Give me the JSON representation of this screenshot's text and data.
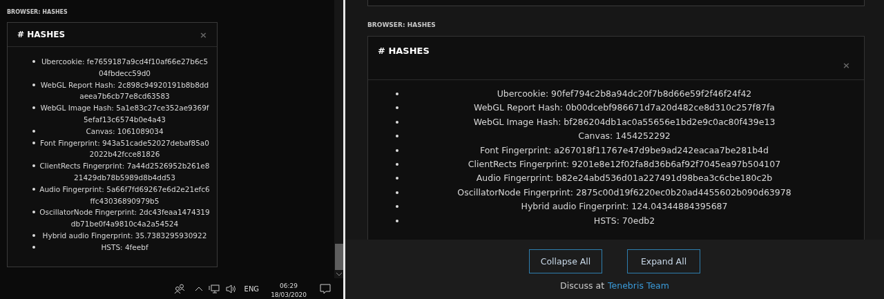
{
  "left_pane": {
    "section_label": "BROWSER: HASHES",
    "panel": {
      "icon": "#",
      "title": "HASHES",
      "close": "×",
      "items": [
        {
          "text": "Ubercookie: fe7659187a9cd4f10af66e27b6c504fbdecc59d0"
        },
        {
          "text": "WebGL Report Hash: 2c898c94920191b8b8ddaeea7b6cb77e8cd63583"
        },
        {
          "text": "WebGL Image Hash: 5a1e83c27ce352ae9369f5efaf13c6574b0e4a43"
        },
        {
          "text": "Canvas: 1061089034"
        },
        {
          "text": "Font Fingerprint: 943a51cade52027debaf85a02022b42fcce81826"
        },
        {
          "text": "ClientRects Fingerprint: 7a44d2526952b261e821429db78b5989d8b4dd53"
        },
        {
          "text": "Audio Fingerprint: 5a66f7fd69267e6d2e21efc6ffc43036890979b5"
        },
        {
          "text": "OscillatorNode Fingerprint: 2dc43feaa1474319db71be0f4a9810c4a2a54524"
        },
        {
          "text": "Hybrid audio Fingerprint: 35.7383295930922"
        },
        {
          "text": "HSTS: 4feebf"
        }
      ]
    }
  },
  "taskbar": {
    "language": "ENG",
    "time": "06:29",
    "date": "18/03/2020"
  },
  "right_pane": {
    "section_label": "BROWSER: HASHES",
    "panel": {
      "icon": "#",
      "title": "HASHES",
      "close": "×",
      "items": [
        {
          "text": "Ubercookie: 90fef794c2b8a94dc20f7b8d66e59f2f46f24f42"
        },
        {
          "text": "WebGL Report Hash: 0b00dcebf986671d7a20d482ce8d310c257f87fa"
        },
        {
          "text": "WebGL Image Hash: bf286204db1ac0a55656e1bd2e9c0ac80f439e13"
        },
        {
          "text": "Canvas: 1454252292"
        },
        {
          "text": "Font Fingerprint: a267018f11767e47d9be9ad242eacaa7be281b4d"
        },
        {
          "text": "ClientRects Fingerprint: 9201e8e12f02fa8d36b6af92f7045ea97b504107"
        },
        {
          "text": "Audio Fingerprint: b82e24abd536d01a227491d98bea3c6cbe180c2b"
        },
        {
          "text": "OscillatorNode Fingerprint: 2875c00d19f6220ec0b20ad4455602b090d63978"
        },
        {
          "text": "Hybrid audio Fingerprint: 124.04344884395687"
        },
        {
          "text": "HSTS: 70edb2"
        }
      ]
    },
    "buttons": [
      "Collapse All",
      "Expand All"
    ],
    "footer": {
      "text": "Discuss at",
      "link": "Tenebris Team"
    }
  }
}
